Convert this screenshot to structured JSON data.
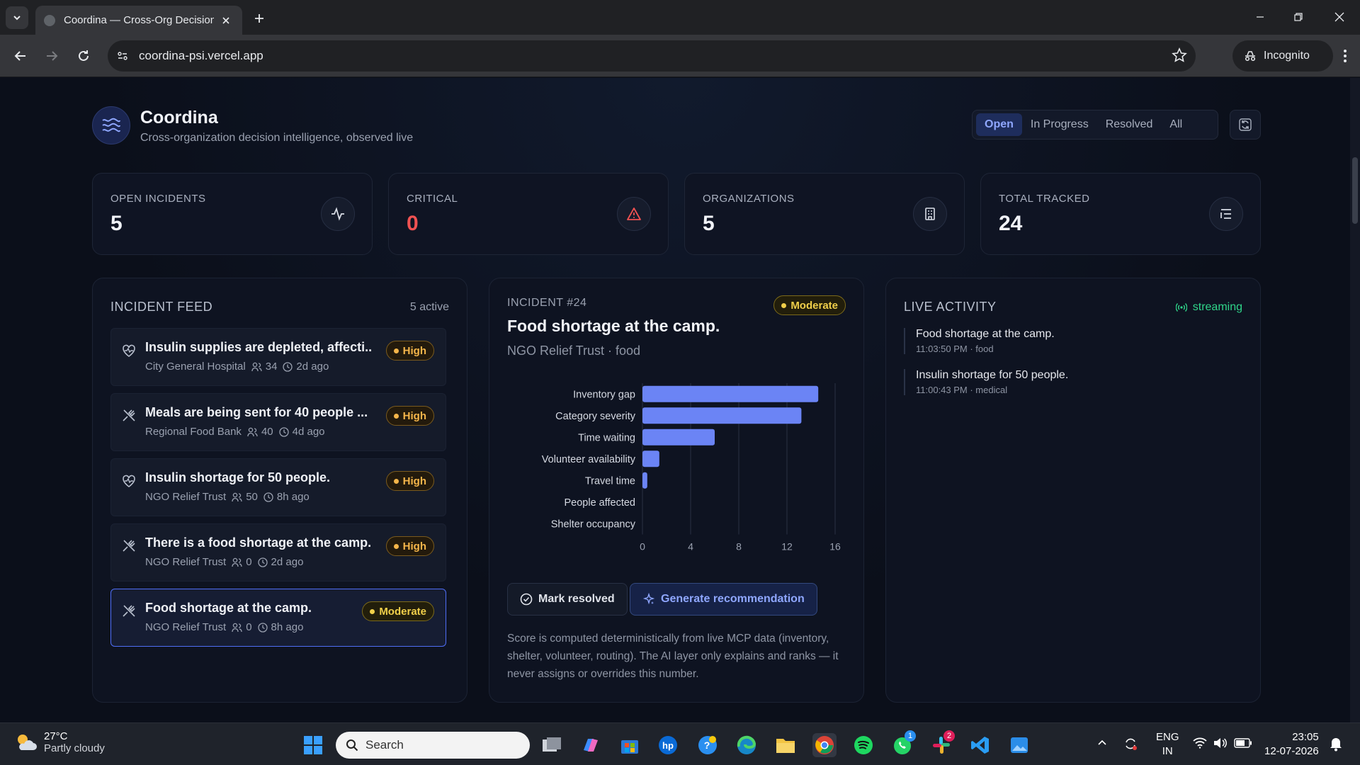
{
  "browser": {
    "tab_title": "Coordina — Cross-Org Decision Intelligence",
    "url": "coordina-psi.vercel.app",
    "incognito_label": "Incognito"
  },
  "app": {
    "name": "Coordina",
    "tagline": "Cross-organization decision intelligence, observed live",
    "filters": [
      "Open",
      "In Progress",
      "Resolved",
      "All"
    ],
    "active_filter": "Open"
  },
  "stats": [
    {
      "label": "OPEN INCIDENTS",
      "value": "5",
      "icon": "activity-icon"
    },
    {
      "label": "CRITICAL",
      "value": "0",
      "icon": "alert-triangle-icon"
    },
    {
      "label": "ORGANIZATIONS",
      "value": "5",
      "icon": "building-icon"
    },
    {
      "label": "TOTAL TRACKED",
      "value": "24",
      "icon": "list-icon"
    }
  ],
  "feed": {
    "heading": "INCIDENT FEED",
    "count": "5 active",
    "items": [
      {
        "title": "Insulin supplies are depleted, affecti...",
        "org": "City General Hospital",
        "people": "34",
        "age": "2d ago",
        "severity": "High",
        "icon": "heart-pulse-icon"
      },
      {
        "title": "Meals are being sent for 40 people ...",
        "org": "Regional Food Bank",
        "people": "40",
        "age": "4d ago",
        "severity": "High",
        "icon": "utensils-icon"
      },
      {
        "title": "Insulin shortage for 50 people.",
        "org": "NGO Relief Trust",
        "people": "50",
        "age": "8h ago",
        "severity": "High",
        "icon": "heart-pulse-icon"
      },
      {
        "title": "There is a food shortage at the camp.",
        "org": "NGO Relief Trust",
        "people": "0",
        "age": "2d ago",
        "severity": "High",
        "icon": "utensils-icon"
      },
      {
        "title": "Food shortage at the camp.",
        "org": "NGO Relief Trust",
        "people": "0",
        "age": "8h ago",
        "severity": "Moderate",
        "icon": "utensils-icon"
      }
    ]
  },
  "incident": {
    "number": "INCIDENT #24",
    "title": "Food shortage at the camp.",
    "subtitle": "NGO Relief Trust · food",
    "severity": "Moderate",
    "resolve_label": "Mark resolved",
    "generate_label": "Generate recommendation",
    "note": "Score is computed deterministically from live MCP data (inventory, shelter, volunteer, routing). The AI layer only explains and ranks — it never assigns or overrides this number."
  },
  "chart_data": {
    "type": "bar",
    "orientation": "horizontal",
    "categories": [
      "Inventory gap",
      "Category severity",
      "Time waiting",
      "Volunteer availability",
      "Travel time",
      "People affected",
      "Shelter occupancy"
    ],
    "values": [
      14.6,
      13.2,
      6.0,
      1.4,
      0.4,
      0,
      0
    ],
    "xlim": [
      0,
      16
    ],
    "xticks": [
      0,
      4,
      8,
      12,
      16
    ],
    "grid": true,
    "bar_color": "#6b84f5"
  },
  "activity": {
    "heading": "LIVE ACTIVITY",
    "status": "streaming",
    "items": [
      {
        "title": "Food shortage at the camp.",
        "meta": "11:03:50 PM · food"
      },
      {
        "title": "Insulin shortage for 50 people.",
        "meta": "11:00:43 PM · medical"
      }
    ]
  },
  "taskbar": {
    "temperature": "27°C",
    "weather": "Partly cloudy",
    "search_placeholder": "Search",
    "lang_top": "ENG",
    "lang_bottom": "IN",
    "time": "23:05",
    "date": "12-07-2026",
    "whatsapp_badge": "1",
    "slack_badge": "2"
  },
  "colors": {
    "accent": "#4f6ef7",
    "critical": "#f05252",
    "high": "#f4b54a",
    "moderate": "#f0cf4a",
    "streaming": "#2fd58a"
  }
}
